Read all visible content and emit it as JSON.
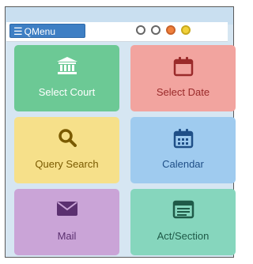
{
  "toolbar": {
    "menu_icon": "hamburger-icon",
    "menu_label": "QMenu",
    "window_dots": [
      {
        "color": "#ffffff",
        "border": "#666666"
      },
      {
        "color": "#ffffff",
        "border": "#666666"
      },
      {
        "color": "#f0803c",
        "border": "#c9622a"
      },
      {
        "color": "#f2d13a",
        "border": "#c9a91e"
      }
    ]
  },
  "tiles": [
    {
      "label": "Select Court",
      "icon": "courthouse-icon",
      "bg": "#6cc995",
      "fg": "#ffffff"
    },
    {
      "label": "Select Date",
      "icon": "calendar-date-icon",
      "bg": "#f2a49f",
      "fg": "#9a2a2a"
    },
    {
      "label": "Query Search",
      "icon": "search-icon",
      "bg": "#f6e08a",
      "fg": "#7a5a00"
    },
    {
      "label": "Calendar",
      "icon": "calendar-icon",
      "bg": "#9fcbef",
      "fg": "#1f4f87"
    },
    {
      "label": "Mail",
      "icon": "mail-icon",
      "bg": "#caa4d7",
      "fg": "#5b3070"
    },
    {
      "label": "Act/Section",
      "icon": "act-section-icon",
      "bg": "#86d6bd",
      "fg": "#1f5a48"
    }
  ]
}
